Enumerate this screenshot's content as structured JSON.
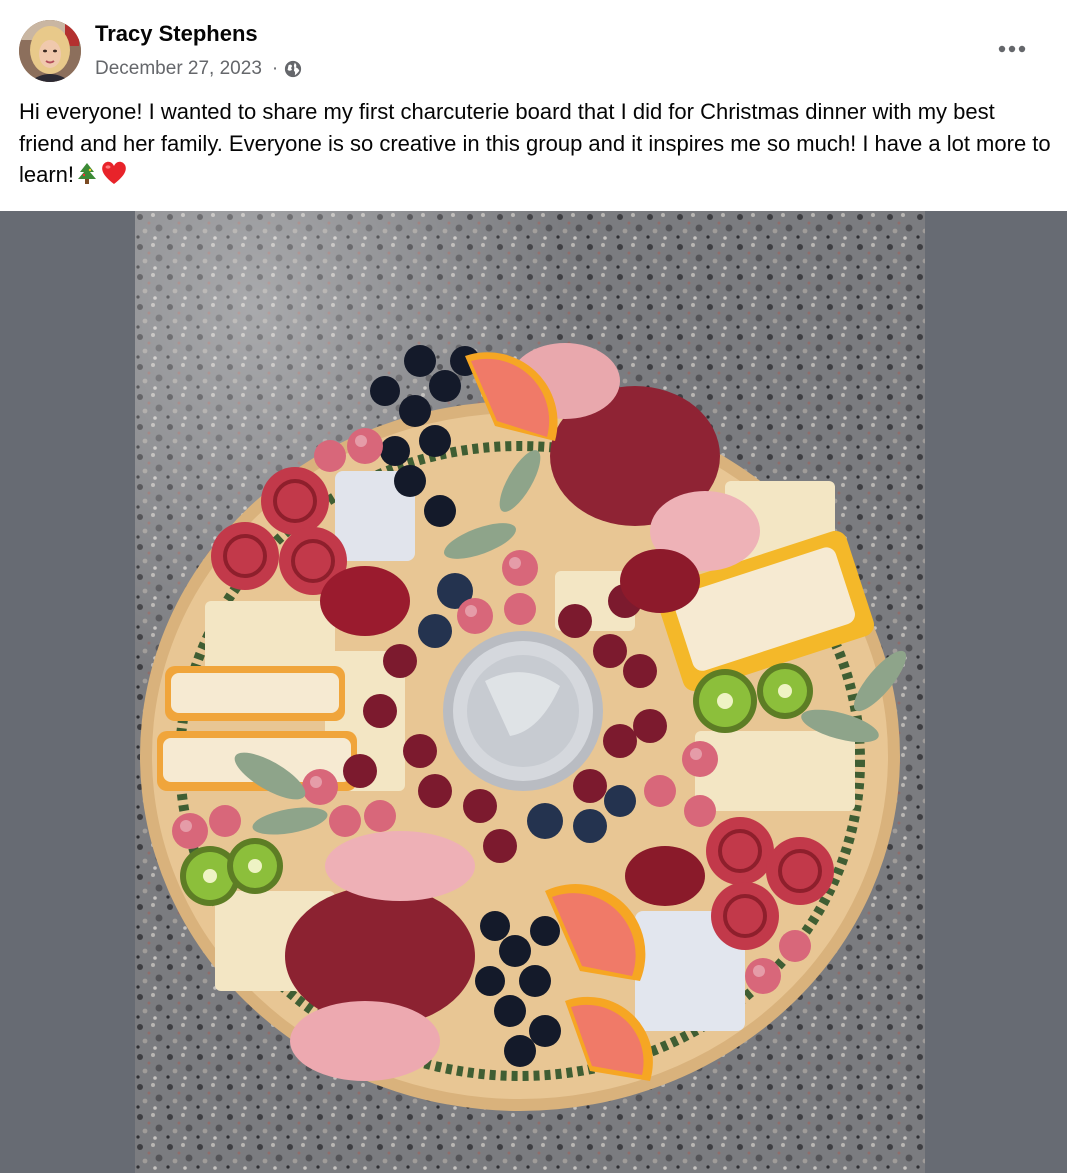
{
  "post": {
    "author": "Tracy Stephens",
    "date": "December 27, 2023",
    "separator": "·",
    "audience_icon": "globe-icon",
    "more_icon": "more-options-icon",
    "text": "Hi everyone! I wanted to share my first charcuterie board that I did for Christmas dinner with my best friend and her family. Everyone is so creative in this group and it inspires me so much! I have a lot more to learn!",
    "emojis": [
      "christmas-tree-emoji",
      "red-heart-emoji"
    ],
    "photo_icon": "charcuterie-board-photo"
  },
  "colors": {
    "text": "#050505",
    "secondary_text": "#65676b",
    "photo_backdrop": "#676b73",
    "card": "#ffffff"
  }
}
